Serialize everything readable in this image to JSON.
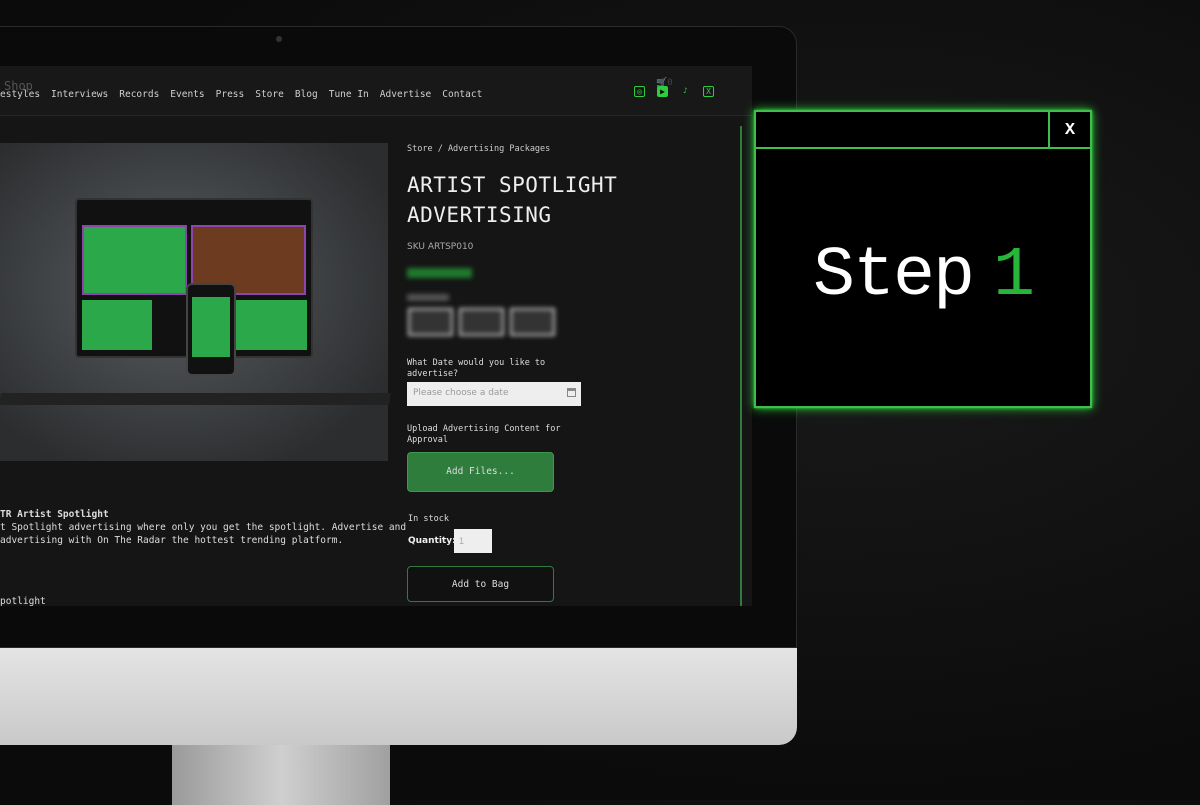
{
  "site": {
    "logo": "Shop",
    "nav": [
      "estyles",
      "Interviews",
      "Records",
      "Events",
      "Press",
      "Store",
      "Blog",
      "Tune In",
      "Advertise",
      "Contact"
    ],
    "cart_count": "0",
    "social_icons": [
      "instagram-icon",
      "youtube-icon",
      "tiktok-icon",
      "x-icon"
    ],
    "accent": "#2ecc40"
  },
  "product": {
    "breadcrumb": "Store / Advertising Packages",
    "title_line1": "ARTIST SPOTLIGHT",
    "title_line2": "ADVERTISING",
    "sku": "SKU ARTSP010",
    "date_label": "What Date would you like to advertise?",
    "date_placeholder": "Please choose a date",
    "upload_label": "Upload Advertising Content for Approval",
    "add_files": "Add Files...",
    "stock": "In stock",
    "quantity_label": "Quantity:",
    "quantity": "1",
    "add_to_bag": "Add to Bag",
    "desc_heading": "TR Artist Spotlight",
    "desc_line1": "t Spotlight advertising where only you get the spotlight. Advertise and",
    "desc_line2": "advertising with On The Radar the hottest trending platform.",
    "desc_footer": "potlight"
  },
  "popup": {
    "close": "X",
    "step_word": "Step",
    "step_number": "1",
    "border_color": "#3fbf4a"
  }
}
